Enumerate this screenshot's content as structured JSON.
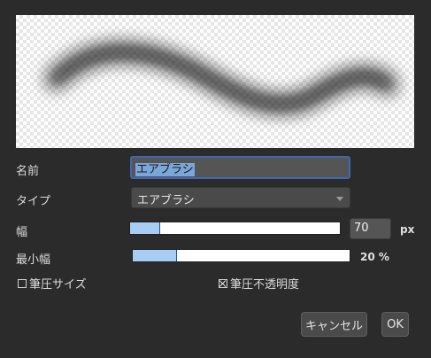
{
  "preview": {
    "description_icon": "airbrush-stroke"
  },
  "form": {
    "name_label": "名前",
    "name_value": "エアブラシ",
    "type_label": "タイプ",
    "type_value": "エアブラシ",
    "width_label": "幅",
    "width_value": "70",
    "width_unit": "px",
    "width_fraction": 0.14,
    "min_width_label": "最小幅",
    "min_width_value": "20 %",
    "min_width_fraction": 0.2,
    "pressure_size_label": "筆圧サイズ",
    "pressure_size_checked": false,
    "pressure_opacity_label": "筆圧不透明度",
    "pressure_opacity_checked": true
  },
  "buttons": {
    "cancel": "キャンセル",
    "ok": "OK"
  },
  "colors": {
    "focus_border": "#3d68b3",
    "slider_fill": "#a7cdf5",
    "background": "#2b2b2b"
  }
}
